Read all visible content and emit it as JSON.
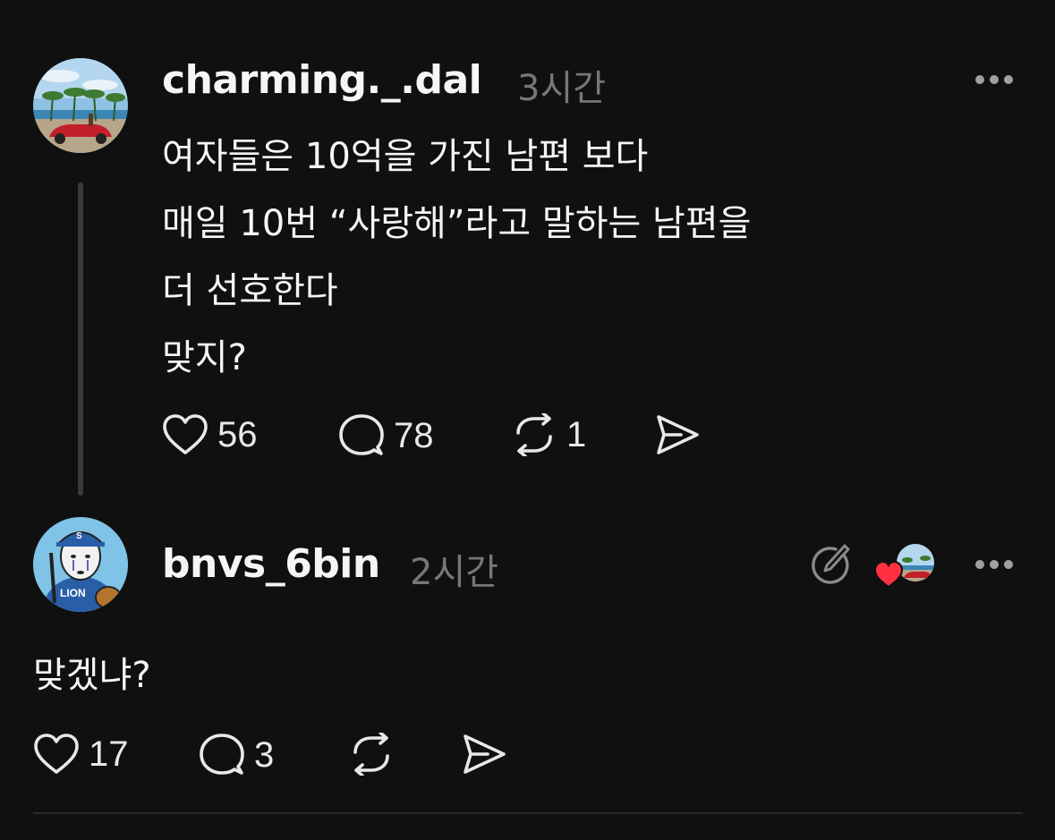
{
  "post1": {
    "username": "charming._.dal",
    "time": "3시간",
    "lines": [
      "여자들은 10억을 가진 남편 보다",
      "매일 10번 “사랑해”라고 말하는 남편을",
      "더 선호한다",
      "맞지?"
    ],
    "likes": "56",
    "replies": "78",
    "reposts": "1",
    "avatar_icon": "beach-car-photo"
  },
  "post2": {
    "username": "bnvs_6bin",
    "time": "2시간",
    "text": "맞겠냐?",
    "likes": "17",
    "replies": "3",
    "reposts": "",
    "avatar_icon": "lions-baseball-mascot",
    "liked_by_author_color": "#ff3040"
  },
  "colors": {
    "background": "#101010",
    "text": "#f3f5f7",
    "muted": "#777777",
    "heart": "#ff3040"
  }
}
